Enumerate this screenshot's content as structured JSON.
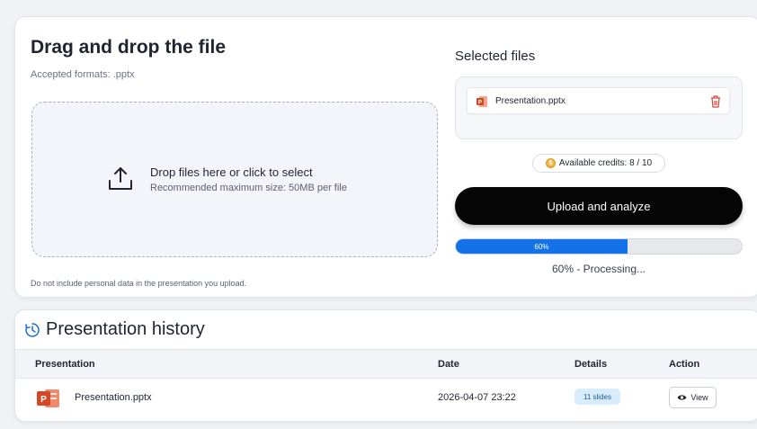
{
  "upload": {
    "title": "Drag and drop the file",
    "accepted_formats": "Accepted formats: .pptx",
    "dropzone": {
      "title": "Drop files here or click to select",
      "subtitle": "Recommended maximum size: 50MB per file",
      "icon": "upload-icon"
    },
    "privacy_note": "Do not include personal data in the presentation you upload."
  },
  "selected": {
    "title": "Selected files",
    "files": [
      {
        "name": "Presentation.pptx",
        "icon": "powerpoint-file-icon"
      }
    ]
  },
  "credits": {
    "label": "Available credits: 8 / 10",
    "icon": "coin-icon"
  },
  "actions": {
    "upload_label": "Upload and analyze"
  },
  "progress": {
    "value": 0.6,
    "bar_label": "60%",
    "status": "60% - Processing..."
  },
  "history": {
    "title": "Presentation history",
    "icon": "history-clock-icon",
    "columns": [
      "Presentation",
      "Date",
      "Details",
      "Action"
    ],
    "rows": [
      {
        "name": "Presentation.pptx",
        "date": "2026-04-07 23:22",
        "details": "11 slides",
        "action": "View"
      }
    ]
  },
  "colors": {
    "accent": "#1372e8",
    "button": "#050505",
    "badge_bg": "#d8ecfb",
    "ppt": "#d24726"
  }
}
